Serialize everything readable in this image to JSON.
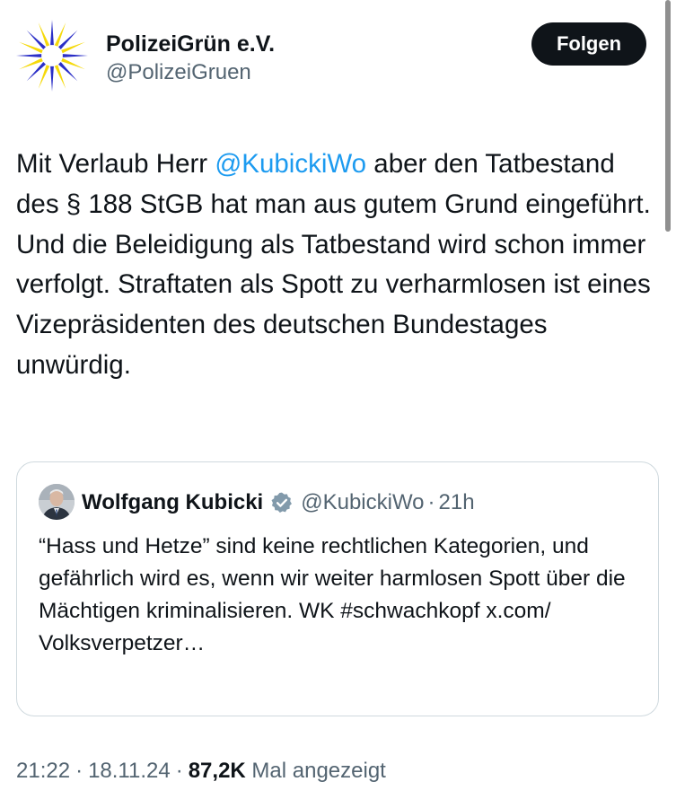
{
  "author": {
    "display_name": "PolizeiGrün e.V.",
    "handle": "@PolizeiGruen",
    "avatar_icon": "sun-burst-logo-icon",
    "logo_colors": [
      "#2b2fc7",
      "#f5d90a"
    ]
  },
  "follow_button": {
    "label": "Folgen"
  },
  "tweet": {
    "text_before": "Mit Verlaub Herr ",
    "mention": "@KubickiWo",
    "text_after": " aber den Tatbestand des § 188 StGB hat man aus gutem Grund eingeführt. Und die Beleidigung als Tatbestand wird schon immer verfolgt. Straftaten als Spott zu verharmlosen ist eines Vizepräsidenten des deutschen Bundestages unwürdig."
  },
  "quote": {
    "display_name": "Wolfgang Kubicki",
    "verified_icon": "verified-badge-icon",
    "handle": "@KubickiWo",
    "separator": "·",
    "time": "21h",
    "text": "“Hass und Hetze” sind keine rechtlichen Kategorien, und gefährlich wird es, wenn wir weiter harmlosen Spott über die Mächtigen kriminalisieren. WK #schwachkopf x.com/ Volksverpetzer…"
  },
  "meta": {
    "time": "21:22",
    "separator": "·",
    "date": "18.11.24",
    "views_count": "87,2K",
    "views_label": "Mal angezeigt"
  },
  "colors": {
    "link": "#1d9bf0",
    "secondary_text": "#536471",
    "primary_text": "#0f1419",
    "button_bg": "#0f1419",
    "border": "#cfd9de"
  }
}
